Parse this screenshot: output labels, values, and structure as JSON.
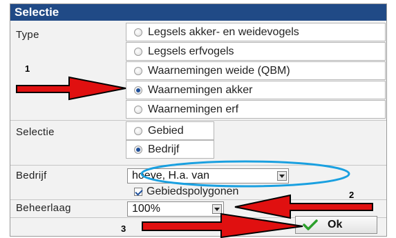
{
  "dialog": {
    "title": "Selectie"
  },
  "type_section": {
    "label": "Type",
    "options": [
      {
        "label": "Legsels akker- en weidevogels",
        "selected": false
      },
      {
        "label": "Legsels erfvogels",
        "selected": false
      },
      {
        "label": "Waarnemingen weide (QBM)",
        "selected": false
      },
      {
        "label": "Waarnemingen akker",
        "selected": true
      },
      {
        "label": "Waarnemingen erf",
        "selected": false
      }
    ]
  },
  "selectie_section": {
    "label": "Selectie",
    "options": [
      {
        "label": "Gebied",
        "selected": false
      },
      {
        "label": "Bedrijf",
        "selected": true
      }
    ]
  },
  "bedrijf_section": {
    "label": "Bedrijf",
    "value": "hoeve, H.a. van",
    "checkbox_label": "Gebiedspolygonen",
    "checkbox_checked": true
  },
  "beheerlaag_section": {
    "label": "Beheerlaag",
    "value": "100%"
  },
  "ok_button": {
    "label": "Ok"
  },
  "annotations": {
    "n1": "1",
    "n2": "2",
    "n3": "3"
  },
  "colors": {
    "titlebar": "#204a86",
    "arrow": "#e01010",
    "ellipse": "#1aa0e0",
    "check": "#2ca02c"
  }
}
